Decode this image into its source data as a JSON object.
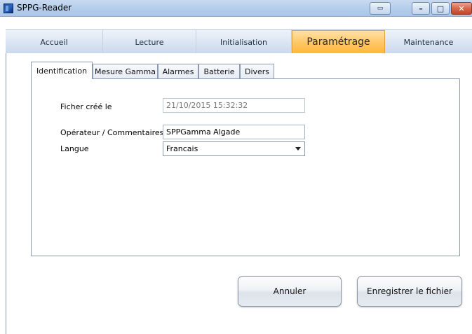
{
  "window": {
    "title": "SPPG-Reader",
    "accent": "#ffc664",
    "buttons": {
      "minimize": "–",
      "maximize": "□",
      "close": "✕"
    }
  },
  "main_tabs": [
    {
      "label": "Accueil",
      "active": false
    },
    {
      "label": "Lecture",
      "active": false
    },
    {
      "label": "Initialisation",
      "active": false
    },
    {
      "label": "Paramétrage",
      "active": true
    },
    {
      "label": "Maintenance",
      "active": false
    }
  ],
  "sub_tabs": [
    {
      "label": "Identification",
      "active": true
    },
    {
      "label": "Mesure Gamma",
      "active": false
    },
    {
      "label": "Alarmes",
      "active": false
    },
    {
      "label": "Batterie",
      "active": false
    },
    {
      "label": "Divers",
      "active": false
    }
  ],
  "form": {
    "created_label": "Ficher créé le",
    "created_value": "21/10/2015 15:32:32",
    "operator_label": "Opérateur / Commentaires",
    "operator_value": "SPPGamma Algade",
    "language_label": "Langue",
    "language_value": "Francais"
  },
  "actions": {
    "cancel": "Annuler",
    "save": "Enregistrer le fichier"
  }
}
